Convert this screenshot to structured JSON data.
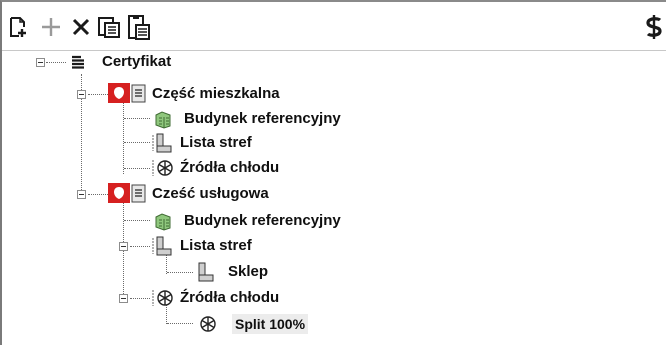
{
  "toolbar": {
    "buttons": [
      {
        "name": "new-document-icon",
        "icon": "new-doc-plus"
      },
      {
        "name": "add-icon",
        "icon": "plus"
      },
      {
        "name": "delete-icon",
        "icon": "x"
      },
      {
        "name": "copy-icon",
        "icon": "copy-doc"
      },
      {
        "name": "paste-icon",
        "icon": "paste-doc"
      }
    ],
    "right_icon": "dollar-icon",
    "colors": {
      "icon": "#1a1a1a",
      "disabled": "#9a9a9a"
    }
  },
  "tree": {
    "root": {
      "label": "Certyfikat",
      "icon": "document-list-icon"
    },
    "sections": [
      {
        "label": "Część mieszkalna",
        "icon": "flag-section-icon",
        "children": [
          {
            "label": "Budynek referencyjny",
            "icon": "building-icon"
          },
          {
            "label": "Lista stref",
            "icon": "zone-list-icon"
          },
          {
            "label": "Źródła chłodu",
            "icon": "snowflake-icon"
          }
        ]
      },
      {
        "label": "Cześć usługowa",
        "icon": "flag-section-icon",
        "children": [
          {
            "label": "Budynek referencyjny",
            "icon": "building-icon"
          },
          {
            "label": "Lista stref",
            "icon": "zone-list-icon",
            "children": [
              {
                "label": "Sklep",
                "icon": "zone-icon"
              }
            ]
          },
          {
            "label": "Źródła chłodu",
            "icon": "snowflake-icon",
            "children": [
              {
                "label": "Split 100%",
                "icon": "snowflake-icon",
                "selected": true
              }
            ]
          }
        ]
      }
    ],
    "colors": {
      "flag_red": "#d62020",
      "building_green": "#6cab5a",
      "line": "#6a6a6a"
    }
  }
}
